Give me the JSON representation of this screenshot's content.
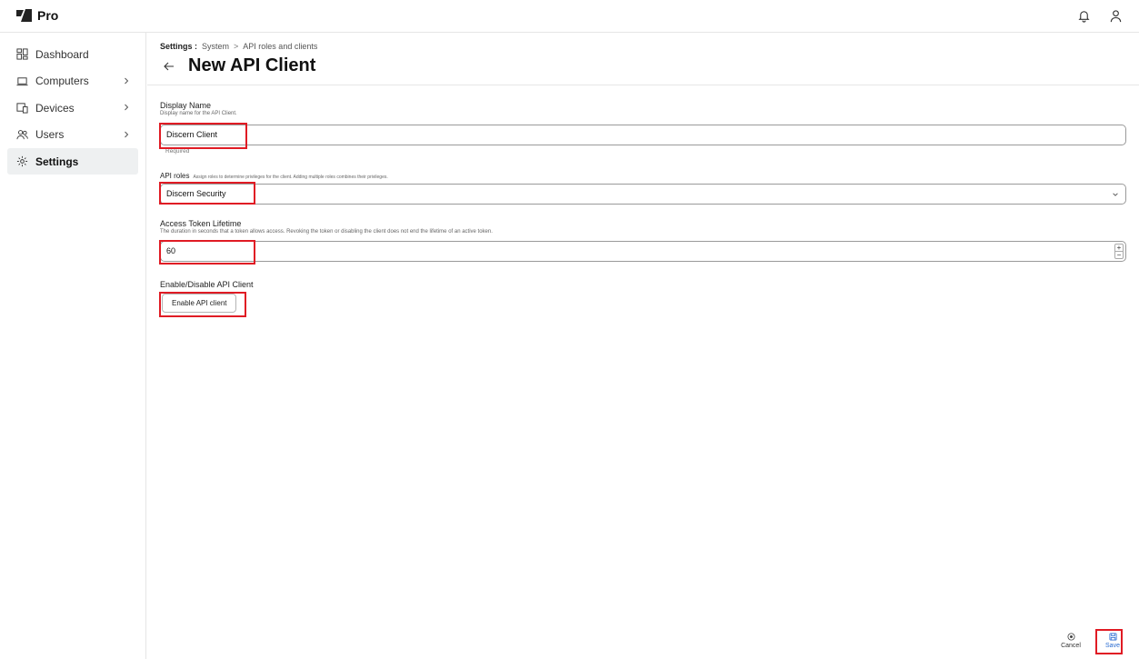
{
  "app": {
    "brand": "Pro"
  },
  "sidebar": {
    "items": [
      {
        "label": "Dashboard",
        "icon": "dashboard-icon",
        "chevron": false,
        "active": false
      },
      {
        "label": "Computers",
        "icon": "laptop-icon",
        "chevron": true,
        "active": false
      },
      {
        "label": "Devices",
        "icon": "devices-icon",
        "chevron": true,
        "active": false
      },
      {
        "label": "Users",
        "icon": "users-icon",
        "chevron": true,
        "active": false
      },
      {
        "label": "Settings",
        "icon": "gear-icon",
        "chevron": false,
        "active": true
      }
    ]
  },
  "header": {
    "breadcrumb": {
      "root": "Settings :",
      "level1": "System",
      "sep": ">",
      "level2": "API roles and clients"
    },
    "title": "New API Client"
  },
  "form": {
    "display_name": {
      "label": "Display Name",
      "help": "Display name for the API Client.",
      "value": "Discern Client",
      "required_text": "Required"
    },
    "api_roles": {
      "label": "API roles",
      "help": "Assign roles to determine privileges for the client. Adding multiple roles combines their privileges.",
      "value": "Discern Security"
    },
    "token_lifetime": {
      "label": "Access Token Lifetime",
      "help": "The duration in seconds that a token allows access. Revoking the token or disabling the client does not end the lifetime of an active token.",
      "value": "60",
      "plus": "+",
      "minus": "−"
    },
    "enable": {
      "label": "Enable/Disable API Client",
      "button": "Enable API client"
    }
  },
  "footer": {
    "cancel": "Cancel",
    "save": "Save"
  },
  "colors": {
    "highlight": "#e01b24",
    "save_blue": "#2a6bd1",
    "active_bg": "#eef0f1"
  }
}
